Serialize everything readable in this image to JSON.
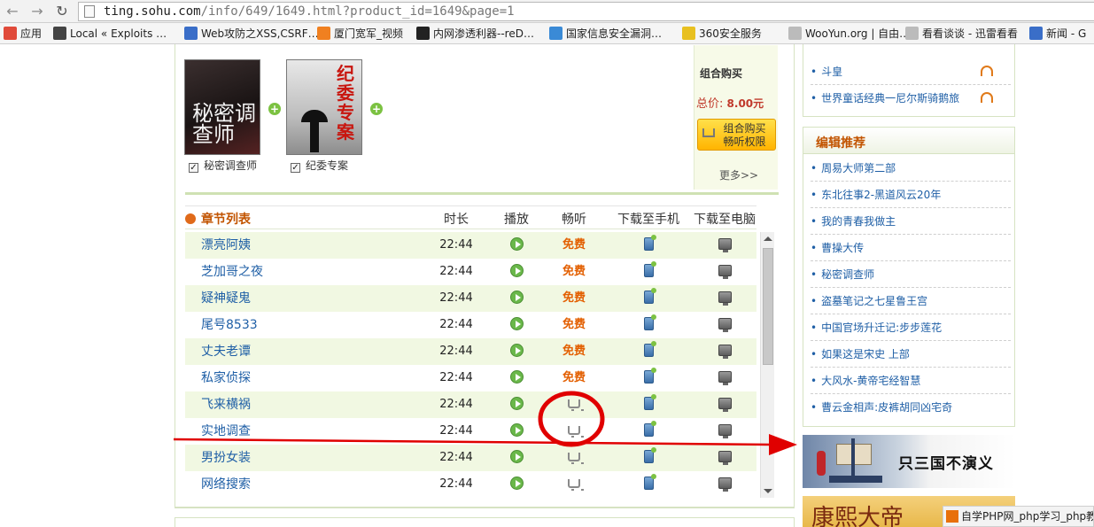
{
  "browser": {
    "url_host": "ting.sohu.com",
    "url_path": "/info/649/1649.html?product_id=1649&page=1",
    "bookmarks": [
      {
        "label": "应用",
        "color": "#e04a3a"
      },
      {
        "label": "Local « Exploits …",
        "color": "#444444"
      },
      {
        "label": "Web攻防之XSS,CSRF…",
        "color": "#3a6ec8"
      },
      {
        "label": "厦门宽军_视频",
        "color": "#f08020"
      },
      {
        "label": "内网渗透利器--reD…",
        "color": "#222222"
      },
      {
        "label": "国家信息安全漏洞…",
        "color": "#3a8ad6"
      },
      {
        "label": "360安全服务",
        "color": "#e8c020"
      },
      {
        "label": "WooYun.org | 自由…",
        "color": "#bbbbbb"
      },
      {
        "label": "看看谈谈 - 迅雷看看",
        "color": "#bbbbbb"
      },
      {
        "label": "新闻 - G",
        "color": "#3a6ec8"
      }
    ]
  },
  "combo": {
    "books": [
      {
        "label": "秘密调查师",
        "cover_text": "秘密调查师",
        "checked": true
      },
      {
        "label": "纪委专案",
        "cover_text": "纪委专案",
        "checked": true
      }
    ],
    "title": "组合购买",
    "price_label": "总价:",
    "price_value": "8.00元",
    "buy_button": "组合购买\n畅听权限",
    "more": "更多>>"
  },
  "table": {
    "headers": {
      "list": "章节列表",
      "duration": "时长",
      "play": "播放",
      "listen": "畅听",
      "phone": "下载至手机",
      "pc": "下载至电脑"
    },
    "rows": [
      {
        "title": "漂亮阿姨",
        "duration": "22:44",
        "listen": "免费",
        "free": true
      },
      {
        "title": "芝加哥之夜",
        "duration": "22:44",
        "listen": "免费",
        "free": true
      },
      {
        "title": "疑神疑鬼",
        "duration": "22:44",
        "listen": "免费",
        "free": true
      },
      {
        "title": "尾号8533",
        "duration": "22:44",
        "listen": "免费",
        "free": true
      },
      {
        "title": "丈夫老谭",
        "duration": "22:44",
        "listen": "免费",
        "free": true
      },
      {
        "title": "私家侦探",
        "duration": "22:44",
        "listen": "免费",
        "free": true
      },
      {
        "title": "飞来横祸",
        "duration": "22:44",
        "listen": "",
        "free": false
      },
      {
        "title": "实地调查",
        "duration": "22:44",
        "listen": "",
        "free": false
      },
      {
        "title": "男扮女装",
        "duration": "22:44",
        "listen": "",
        "free": false
      },
      {
        "title": "网络搜索",
        "duration": "22:44",
        "listen": "",
        "free": false
      }
    ]
  },
  "sidebar": {
    "top_list": [
      "斗皇",
      "世界童话经典一尼尔斯骑鹅旅"
    ],
    "recommend_title": "编辑推荐",
    "recommend": [
      "周易大师第二部",
      "东北往事2-黑道风云20年",
      "我的青春我做主",
      "曹操大传",
      "秘密调查师",
      "盗墓笔记之七星鲁王宫",
      "中国官场升迁记:步步莲花",
      "如果这是宋史 上部",
      "大风水-黄帝宅经智慧",
      "曹云金相声:皮裤胡同凶宅奇"
    ],
    "banner1_text": "只三国不演义",
    "banner2_text": "康熙大帝"
  },
  "watermark": "自学PHP网_php学习_php教",
  "colors": {
    "accent_orange": "#c25400",
    "link_blue": "#1f5fa6",
    "free_orange": "#e35f00",
    "annotation_red": "#e00000"
  }
}
